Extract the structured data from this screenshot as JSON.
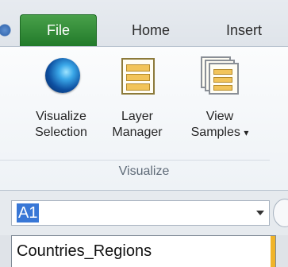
{
  "tabs": [
    {
      "label": "File",
      "active": true
    },
    {
      "label": "Home",
      "active": false
    },
    {
      "label": "Insert",
      "active": false
    }
  ],
  "ribbon": {
    "buttons": [
      {
        "label_line1": "Visualize",
        "label_line2": "Selection",
        "icon": "globe-icon"
      },
      {
        "label_line1": "Layer",
        "label_line2": "Manager",
        "icon": "layer-manager-icon"
      },
      {
        "label_line1": "View",
        "label_line2": "Samples",
        "icon": "view-samples-icon",
        "has_dropdown": true,
        "dropdown_glyph": "▾"
      }
    ],
    "group_label": "Visualize"
  },
  "namebox": {
    "value": "A1"
  },
  "dropdown_list": {
    "items": [
      "Countries_Regions"
    ]
  },
  "colors": {
    "file_tab": "#217a2a",
    "selection": "#3877d6",
    "scroll_accent": "#f0b429"
  }
}
